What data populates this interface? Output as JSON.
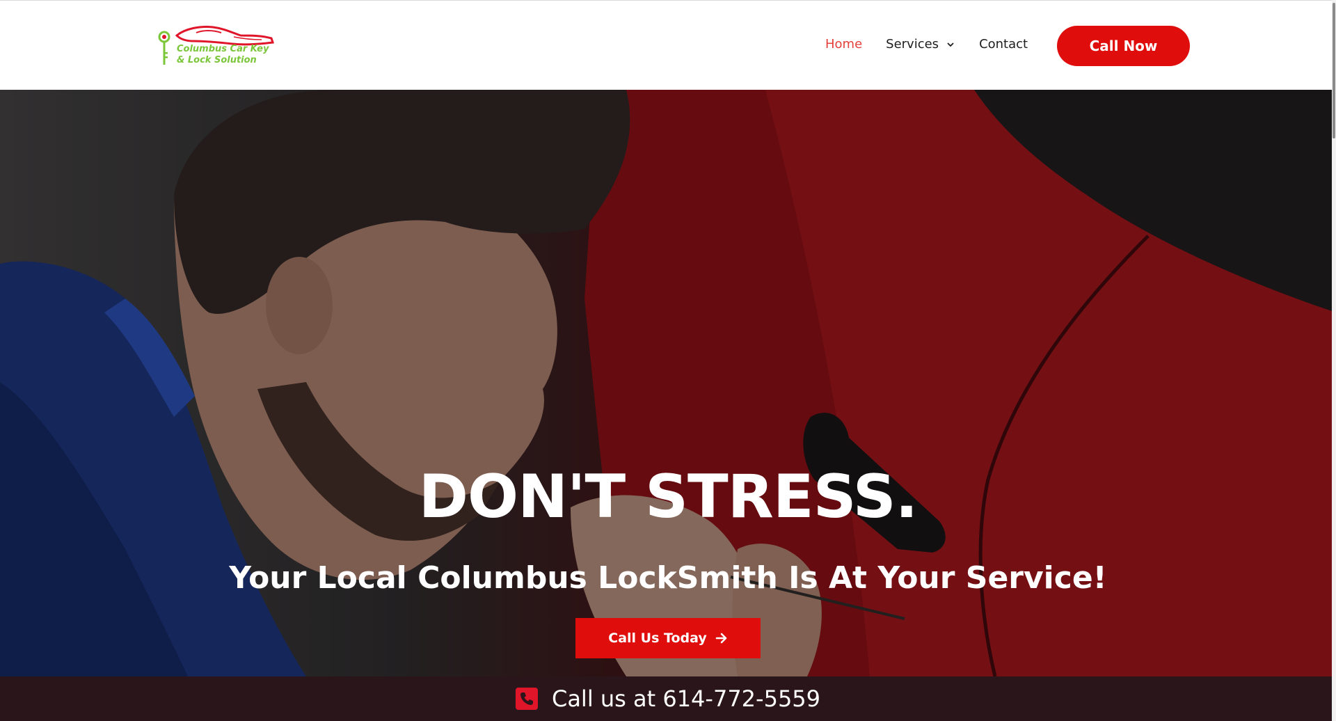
{
  "header": {
    "logo_text_line1": "Columbus Car Key",
    "logo_text_line2": "& Lock Solution",
    "nav": {
      "home": "Home",
      "services": "Services",
      "contact": "Contact"
    },
    "call_now": "Call Now"
  },
  "hero": {
    "heading": "DON'T STRESS.",
    "subheading": "Your Local Columbus LockSmith Is At Your Service!",
    "cta_label": "Call Us Today"
  },
  "callbar": {
    "text": "Call us at 614-772-5559"
  },
  "colors": {
    "accent_red": "#e00d0d",
    "nav_active": "#e4403b",
    "logo_green": "#7cc63a",
    "callbar_bg": "#2a161a"
  },
  "icons": [
    "key-car-logo-icon",
    "chevron-down-icon",
    "arrow-right-icon",
    "phone-icon"
  ]
}
